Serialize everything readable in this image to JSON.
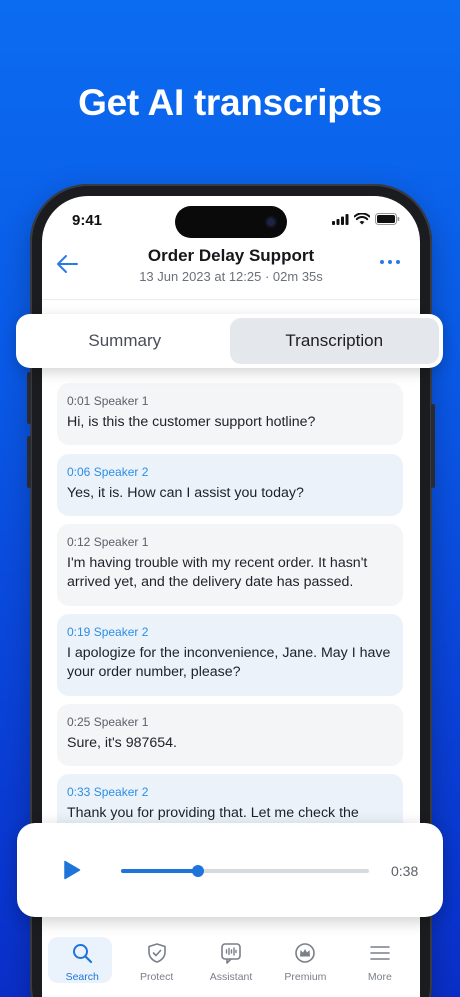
{
  "promo": {
    "title": "Get AI transcripts"
  },
  "status_bar": {
    "time": "9:41"
  },
  "header": {
    "title": "Order Delay Support",
    "subtitle": "13 Jun 2023 at 12:25 · 02m 35s"
  },
  "tabs": [
    {
      "label": "Summary",
      "active": false
    },
    {
      "label": "Transcription",
      "active": true
    }
  ],
  "messages": [
    {
      "meta": "0:01 Speaker 1",
      "text": "Hi, is this the customer support hotline?"
    },
    {
      "meta": "0:06 Speaker 2",
      "text": "Yes, it is. How can I assist you today?"
    },
    {
      "meta": "0:12 Speaker 1",
      "text": "I'm having trouble with my recent order. It hasn't arrived yet, and the delivery date has passed."
    },
    {
      "meta": "0:19 Speaker 2",
      "text": "I apologize for the inconvenience, Jane. May I have your order number, please?"
    },
    {
      "meta": "0:25 Speaker 1",
      "text": "Sure, it's 987654."
    },
    {
      "meta": "0:33 Speaker 2",
      "text": "Thank you for providing that. Let me check the"
    }
  ],
  "player": {
    "time": "0:38",
    "progress": 0.31
  },
  "nav": [
    {
      "label": "Search",
      "icon": "search-icon",
      "active": true
    },
    {
      "label": "Protect",
      "icon": "shield-icon",
      "active": false
    },
    {
      "label": "Assistant",
      "icon": "assistant-icon",
      "active": false
    },
    {
      "label": "Premium",
      "icon": "crown-icon",
      "active": false
    },
    {
      "label": "More",
      "icon": "menu-icon",
      "active": false
    }
  ],
  "colors": {
    "accent": "#1f74d9",
    "speaker2": "#2d8ee3",
    "background_top": "#0b6cf0",
    "background_bottom": "#0a2fc9"
  }
}
